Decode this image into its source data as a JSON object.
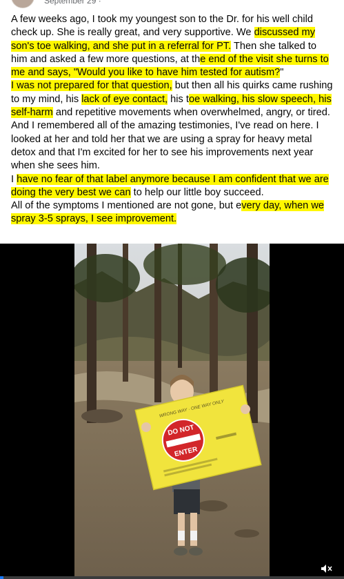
{
  "post": {
    "date": "September 29 · ",
    "paragraphs": [
      [
        {
          "t": "A few weeks ago, I took my youngest son to the Dr. for his well child check up. She is really great, and very supportive. We ",
          "h": false
        },
        {
          "t": "discussed my son's toe walking, and she put in a referral for PT.",
          "h": true
        },
        {
          "t": " Then she talked to him and asked a few more questions, at th",
          "h": false
        },
        {
          "t": "e end of the visit she turns to me and says, \"Would you like to have him tested for autism?",
          "h": true
        },
        {
          "t": "\"",
          "h": false
        }
      ],
      [
        {
          "t": "I was not prepared for that question,",
          "h": true
        },
        {
          "t": " but then all his quirks came rushing to my mind, his ",
          "h": false
        },
        {
          "t": "lack of eye contact,",
          "h": true
        },
        {
          "t": " his t",
          "h": false
        },
        {
          "t": "oe walking, his slow speech, his self-harm",
          "h": true
        },
        {
          "t": " and repetitive movements when overwhelmed, angry, or tired.",
          "h": false
        }
      ],
      [
        {
          "t": "And I remembered all of the amazing testimonies, I've read on here. I looked at her and told her that we are using a spray for heavy metal detox and that I'm excited for her to see his improvements next year when she sees him.",
          "h": false
        }
      ],
      [
        {
          "t": "I ",
          "h": false
        },
        {
          "t": "have no fear of that label anymore because I am confident that we are doing the very best we can",
          "h": true
        },
        {
          "t": " to help our little boy succeed.",
          "h": false
        }
      ],
      [
        {
          "t": "All of the symptoms I mentioned are not gone, but e",
          "h": false
        },
        {
          "t": "very day, when we spray 3-5 sprays, I see improvement.",
          "h": true
        }
      ]
    ]
  },
  "photo": {
    "sign_text_line1": "DO NOT",
    "sign_text_line2": "ENTER",
    "sign_top_text": "WRONG WAY · ONE WAY ONLY"
  },
  "video": {
    "progress": 0.01
  },
  "colors": {
    "highlight": "#fff700",
    "accent": "#1877f2"
  },
  "icons": {
    "volume": "volume-icon"
  }
}
